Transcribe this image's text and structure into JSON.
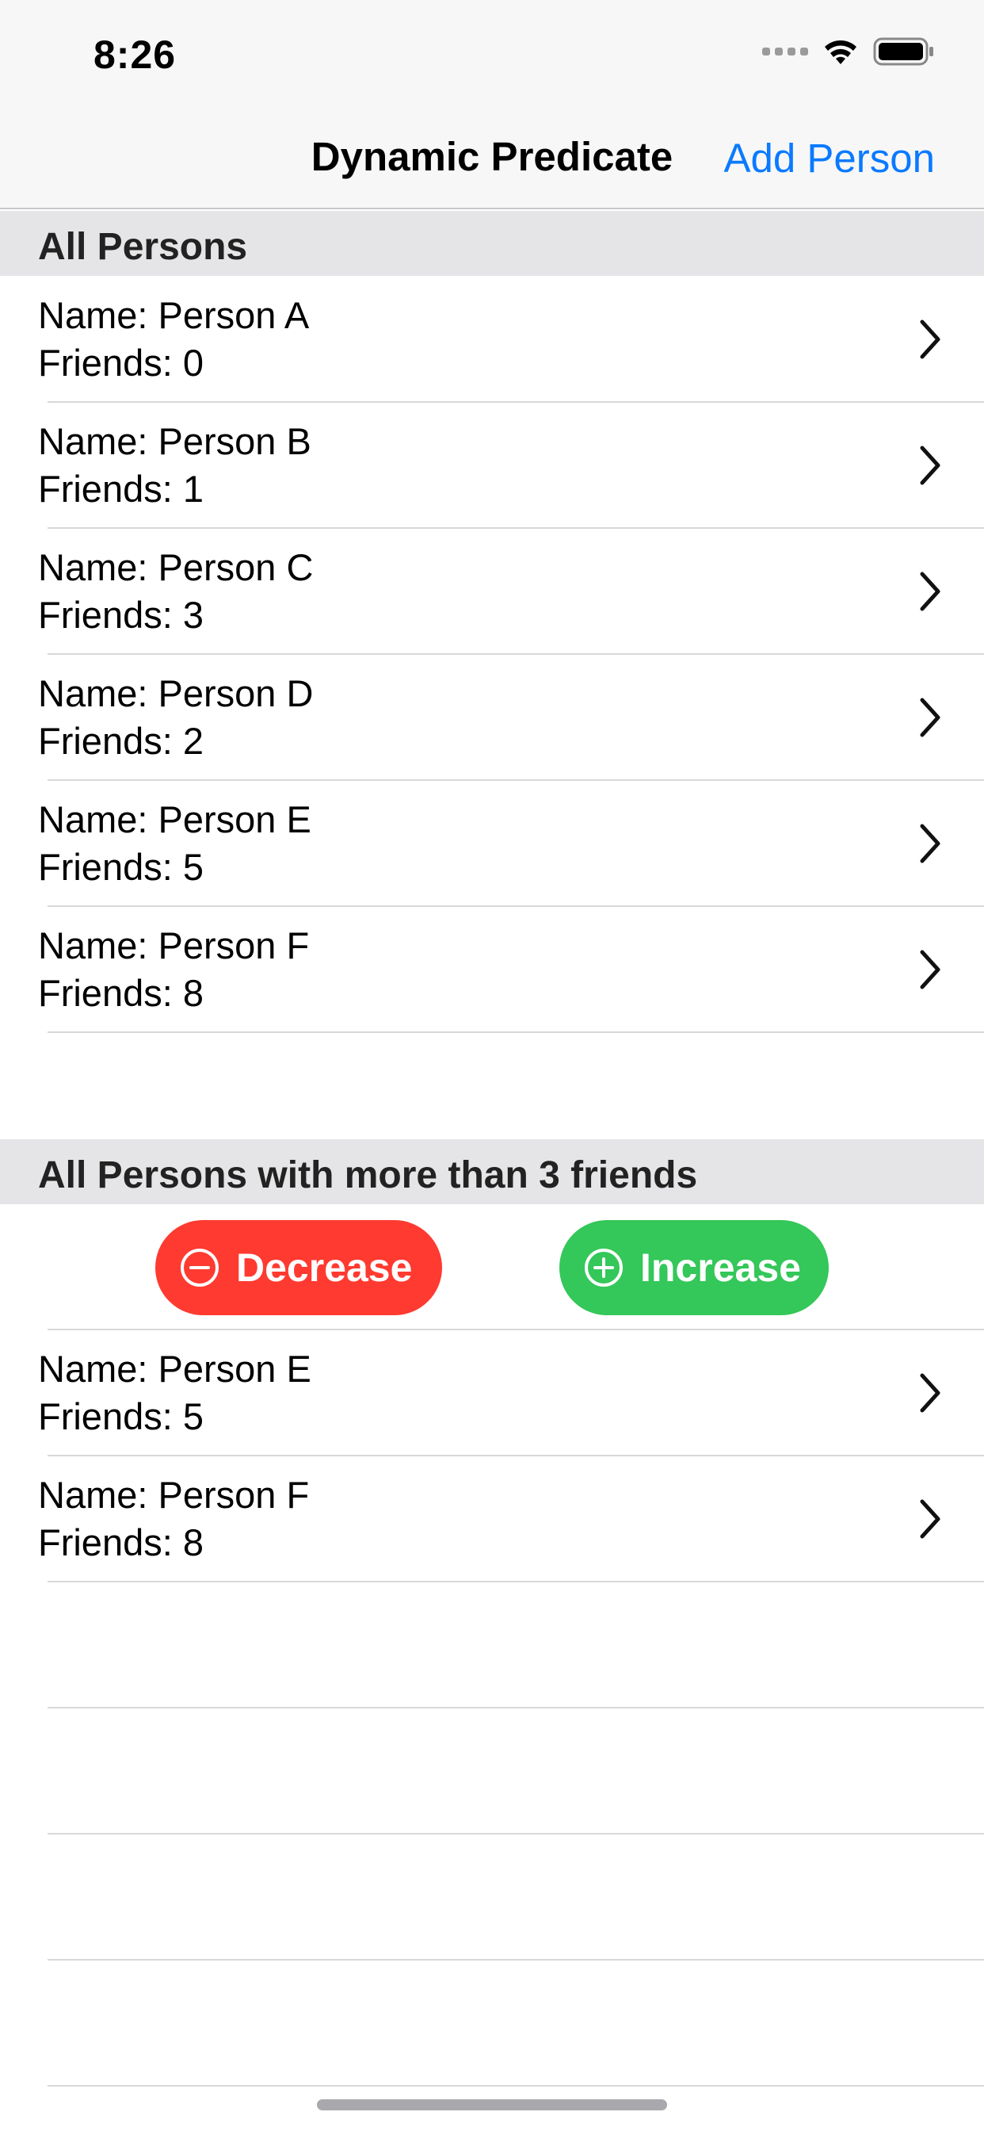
{
  "status_bar": {
    "time": "8:26"
  },
  "nav": {
    "title": "Dynamic Predicate",
    "action": "Add Person"
  },
  "section_all": {
    "header": "All Persons",
    "rows": [
      {
        "name": "Name: Person A",
        "friends": "Friends: 0"
      },
      {
        "name": "Name: Person B",
        "friends": "Friends: 1"
      },
      {
        "name": "Name: Person C",
        "friends": "Friends: 3"
      },
      {
        "name": "Name: Person D",
        "friends": "Friends: 2"
      },
      {
        "name": "Name: Person E",
        "friends": "Friends: 5"
      },
      {
        "name": "Name: Person F",
        "friends": "Friends: 8"
      }
    ]
  },
  "section_filtered": {
    "header": "All Persons with more than 3 friends",
    "decrease_label": "Decrease",
    "increase_label": "Increase",
    "rows": [
      {
        "name": "Name: Person E",
        "friends": "Friends: 5"
      },
      {
        "name": "Name: Person F",
        "friends": "Friends: 8"
      }
    ]
  },
  "colors": {
    "accent": "#0a7aff",
    "decrease": "#ff3a30",
    "increase": "#34c759"
  }
}
